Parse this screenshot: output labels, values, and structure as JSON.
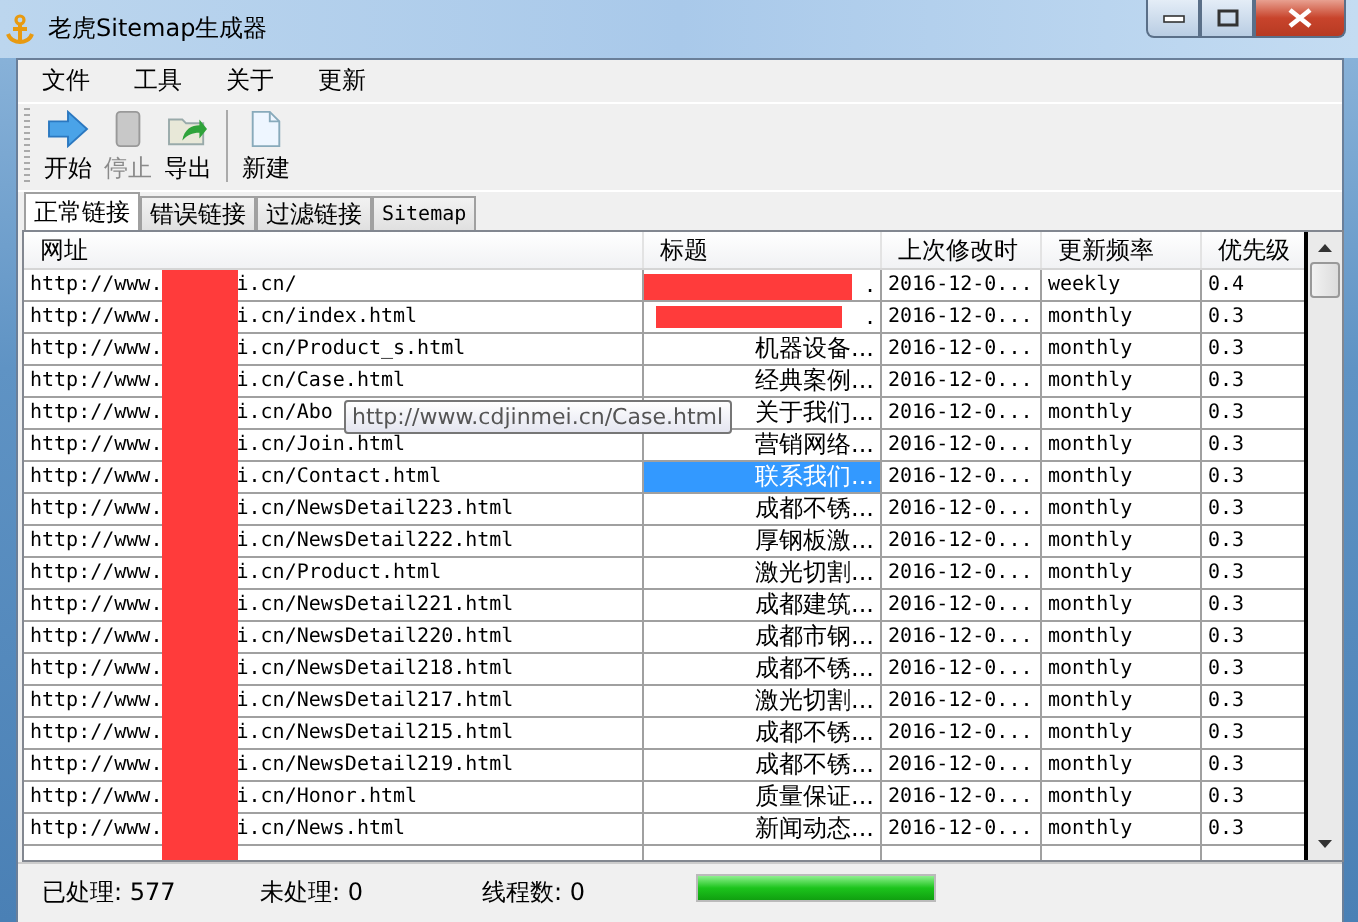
{
  "window": {
    "title": "老虎Sitemap生成器"
  },
  "menu": [
    "文件",
    "工具",
    "关于",
    "更新"
  ],
  "toolbar": [
    {
      "kind": "start",
      "label": "开始",
      "disabled": false
    },
    {
      "kind": "stop",
      "label": "停止",
      "disabled": true
    },
    {
      "kind": "export",
      "label": "导出",
      "disabled": false
    },
    {
      "kind": "new",
      "label": "新建",
      "disabled": false
    }
  ],
  "tabs": [
    {
      "label": "正常链接",
      "selected": true
    },
    {
      "label": "错误链接",
      "selected": false
    },
    {
      "label": "过滤链接",
      "selected": false
    },
    {
      "label": "Sitemap",
      "selected": false
    }
  ],
  "table": {
    "columns": [
      "网址",
      "标题",
      "上次修改时",
      "更新频率",
      "优先级"
    ],
    "rows": [
      {
        "url_start": "http://www.",
        "url_end": "i.cn/",
        "title": ".",
        "title_redacted": true,
        "modified": "2016-12-0...",
        "frequency": "weekly",
        "priority": "0.4",
        "selected": false
      },
      {
        "url_start": "http://www.",
        "url_end": "i.cn/index.html",
        "title": ".",
        "title_redacted": true,
        "modified": "2016-12-0...",
        "frequency": "monthly",
        "priority": "0.3",
        "selected": false
      },
      {
        "url_start": "http://www.",
        "url_end": "i.cn/Product_s.html",
        "title": "机器设备...",
        "modified": "2016-12-0...",
        "frequency": "monthly",
        "priority": "0.3",
        "selected": false
      },
      {
        "url_start": "http://www.",
        "url_end": "i.cn/Case.html",
        "title": "经典案例...",
        "modified": "2016-12-0...",
        "frequency": "monthly",
        "priority": "0.3",
        "selected": false
      },
      {
        "url_start": "http://www.",
        "url_end": "i.cn/Abo",
        "title": "关于我们...",
        "modified": "2016-12-0...",
        "frequency": "monthly",
        "priority": "0.3",
        "selected": false
      },
      {
        "url_start": "http://www.",
        "url_end": "i.cn/Join.html",
        "title": "营销网络...",
        "modified": "2016-12-0...",
        "frequency": "monthly",
        "priority": "0.3",
        "selected": false
      },
      {
        "url_start": "http://www.",
        "url_end": "i.cn/Contact.html",
        "title": "联系我们...",
        "modified": "2016-12-0...",
        "frequency": "monthly",
        "priority": "0.3",
        "selected": true
      },
      {
        "url_start": "http://www.",
        "url_end": "i.cn/NewsDetail223.html",
        "title": "成都不锈...",
        "modified": "2016-12-0...",
        "frequency": "monthly",
        "priority": "0.3",
        "selected": false
      },
      {
        "url_start": "http://www.",
        "url_end": "i.cn/NewsDetail222.html",
        "title": "厚钢板激...",
        "modified": "2016-12-0...",
        "frequency": "monthly",
        "priority": "0.3",
        "selected": false
      },
      {
        "url_start": "http://www.",
        "url_end": "i.cn/Product.html",
        "title": "激光切割...",
        "modified": "2016-12-0...",
        "frequency": "monthly",
        "priority": "0.3",
        "selected": false
      },
      {
        "url_start": "http://www.",
        "url_end": "i.cn/NewsDetail221.html",
        "title": "成都建筑...",
        "modified": "2016-12-0...",
        "frequency": "monthly",
        "priority": "0.3",
        "selected": false
      },
      {
        "url_start": "http://www.",
        "url_end": "i.cn/NewsDetail220.html",
        "title": "成都市钢...",
        "modified": "2016-12-0...",
        "frequency": "monthly",
        "priority": "0.3",
        "selected": false
      },
      {
        "url_start": "http://www.",
        "url_end": "i.cn/NewsDetail218.html",
        "title": "成都不锈...",
        "modified": "2016-12-0...",
        "frequency": "monthly",
        "priority": "0.3",
        "selected": false
      },
      {
        "url_start": "http://www.",
        "url_end": "i.cn/NewsDetail217.html",
        "title": "激光切割...",
        "modified": "2016-12-0...",
        "frequency": "monthly",
        "priority": "0.3",
        "selected": false
      },
      {
        "url_start": "http://www.",
        "url_end": "i.cn/NewsDetail215.html",
        "title": "成都不锈...",
        "modified": "2016-12-0...",
        "frequency": "monthly",
        "priority": "0.3",
        "selected": false
      },
      {
        "url_start": "http://www.",
        "url_end": "i.cn/NewsDetail219.html",
        "title": "成都不锈...",
        "modified": "2016-12-0...",
        "frequency": "monthly",
        "priority": "0.3",
        "selected": false
      },
      {
        "url_start": "http://www.",
        "url_end": "i.cn/Honor.html",
        "title": "质量保证...",
        "modified": "2016-12-0...",
        "frequency": "monthly",
        "priority": "0.3",
        "selected": false
      },
      {
        "url_start": "http://www.",
        "url_end": "i.cn/News.html",
        "title": "新闻动态...",
        "modified": "2016-12-0...",
        "frequency": "monthly",
        "priority": "0.3",
        "selected": false
      }
    ]
  },
  "tooltip": {
    "text": "http://www.cdjinmei.cn/Case.html"
  },
  "status_bar": {
    "processed": "已处理: 577",
    "pending": "未处理: 0",
    "threads": "线程数: 0",
    "level": 1
  }
}
